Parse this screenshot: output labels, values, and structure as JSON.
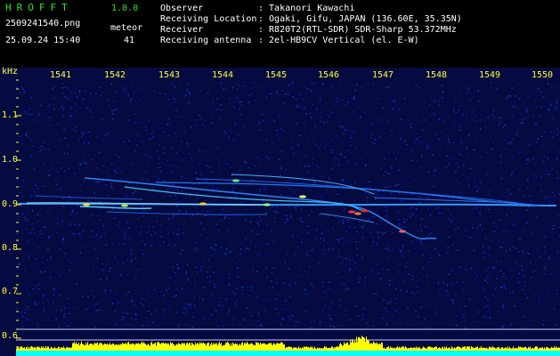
{
  "header": {
    "app_name": "HROFFT",
    "version": "1.0.0",
    "filename": "2509241540.png",
    "meteor_label": "meteor",
    "datetime": "25.09.24 15:40",
    "meteor_count": "41",
    "info_labels": [
      "Observer",
      "Receiving Location",
      "Receiver",
      "Receiving antenna"
    ],
    "info_values": [
      ": Takanori Kawachi",
      ": Ogaki, Gifu, JAPAN (136.60E, 35.35N)",
      ": R820T2(RTL-SDR) SDR-Sharp 53.372MHz",
      ": 2el-HB9CV Vertical (el. E-W)"
    ]
  },
  "plot": {
    "y_unit": "kHz",
    "x_ticks": [
      "1541",
      "1542",
      "1543",
      "1544",
      "1545",
      "1546",
      "1547",
      "1548",
      "1549",
      "1550"
    ],
    "y_ticks": [
      "1.1",
      "1.0",
      "0.9",
      "0.8",
      "0.7",
      "0.6"
    ]
  },
  "colors": {
    "background": "#000000",
    "noise": "#0a1480",
    "header_green": "#22e622",
    "tick_yellow": "#ffff33",
    "power_yellow": "#ffff00",
    "power_cyan": "#00ffff"
  }
}
